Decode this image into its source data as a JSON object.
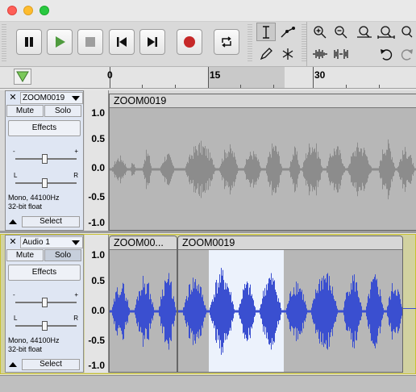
{
  "window": {
    "buttons": [
      "close",
      "minimize",
      "zoom"
    ]
  },
  "toolbar": {
    "transport": [
      {
        "name": "pause",
        "icon": "pause-icon"
      },
      {
        "name": "play",
        "icon": "play-icon"
      },
      {
        "name": "stop",
        "icon": "stop-icon"
      },
      {
        "name": "skip-to-start",
        "icon": "skip-start-icon"
      },
      {
        "name": "skip-to-end",
        "icon": "skip-end-icon"
      },
      {
        "name": "record",
        "icon": "record-icon"
      },
      {
        "name": "loop",
        "icon": "loop-icon"
      }
    ],
    "tools": [
      "selection-tool",
      "envelope-tool",
      "draw-tool",
      "multi-tool"
    ],
    "active_tool": "selection-tool",
    "zoom_tools": [
      "zoom-in",
      "zoom-out",
      "fit-selection",
      "fit-project",
      "zoom-toggle",
      "trim-outside",
      "silence-selection",
      "undo",
      "redo"
    ]
  },
  "ruler": {
    "labels": [
      "0",
      "15",
      "30"
    ]
  },
  "tracks": [
    {
      "name": "ZOOM0019",
      "mute_label": "Mute",
      "solo_label": "Solo",
      "solo_active": false,
      "effects_label": "Effects",
      "gain_minus": "-",
      "gain_plus": "+",
      "pan_left": "L",
      "pan_right": "R",
      "info_line1": "Mono, 44100Hz",
      "info_line2": "32-bit float",
      "select_label": "Select",
      "scale": [
        "1.0",
        "0.5",
        "0.0",
        "-0.5",
        "-1.0"
      ],
      "clips": [
        {
          "title": "ZOOM0019"
        }
      ],
      "wave_color": "#8c8c8c"
    },
    {
      "name": "Audio 1",
      "mute_label": "Mute",
      "solo_label": "Solo",
      "solo_active": true,
      "effects_label": "Effects",
      "gain_minus": "-",
      "gain_plus": "+",
      "pan_left": "L",
      "pan_right": "R",
      "info_line1": "Mono, 44100Hz",
      "info_line2": "32-bit float",
      "select_label": "Select",
      "scale": [
        "1.0",
        "0.5",
        "0.0",
        "-0.5",
        "-1.0"
      ],
      "clips": [
        {
          "title": "ZOOM00..."
        },
        {
          "title": "ZOOM0019"
        }
      ],
      "wave_color": "#3a4fd0"
    }
  ],
  "colors": {
    "selection": "#ecf2fc",
    "wave_grey": "#8c8c8c",
    "wave_blue": "#3a4fd0",
    "record_red": "#c62828",
    "play_green": "#4f9b3e"
  }
}
